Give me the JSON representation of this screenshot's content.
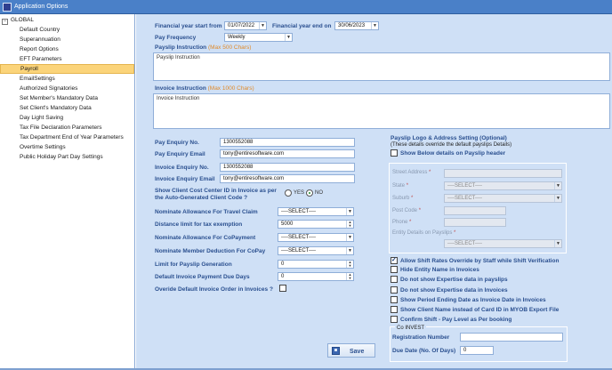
{
  "window": {
    "title": "Application Options"
  },
  "tree": {
    "root_label": "GLOBAL",
    "items": [
      "Default Country",
      "Superannuation",
      "Report Options",
      "EFT Parameters",
      "Payroll",
      "EmailSettings",
      "Authorized Signatories",
      "Set Member's Mandatory Data",
      "Set Client's Mandatory Data",
      "Day Light Saving",
      "Tax File Declaration Parameters",
      "Tax Department End of Year Parameters",
      "Overtime Settings",
      "Public Holiday Part Day Settings"
    ],
    "selected": "Payroll"
  },
  "financial": {
    "start_label": "Financial year start from",
    "start_value": "01/07/2022",
    "end_label": "Financial year end on",
    "end_value": "30/06/2023"
  },
  "pay_frequency": {
    "label": "Pay Frequency",
    "value": "Weekly"
  },
  "payslip_instruction": {
    "label": "Payslip Instruction",
    "hint": "(Max 500 Chars)",
    "placeholder": "Payslip Instruction"
  },
  "invoice_instruction": {
    "label": "Invoice Instruction",
    "hint": "(Max 1000 Chars)",
    "placeholder": "Invoice Instruction"
  },
  "enquiry": {
    "pay_no_label": "Pay Enquiry No.",
    "pay_no_value": "1300552088",
    "pay_email_label": "Pay Enquiry Email",
    "pay_email_value": "tony@entiresoftware.com",
    "inv_no_label": "Invoice Enquiry No.",
    "inv_no_value": "1300552088",
    "inv_email_label": "Invoice Enquiry Email",
    "inv_email_value": "tony@entiresoftware.com"
  },
  "cost_center": {
    "label_line1": "Show Client Cost Center ID in Invoice as per",
    "label_line2": "the Auto-Generated Client Code ?",
    "yes": "YES",
    "no": "NO",
    "selected": "NO"
  },
  "settings": {
    "travel_label": "Nominate Allowance For Travel Claim",
    "travel_value": "----SELECT----",
    "distance_label": "Distance limit for tax exemption",
    "distance_value": "5000",
    "copayment_label": "Nominate Allowance For CoPayment",
    "copayment_value": "----SELECT----",
    "deduction_label": "Nominate Member Deduction For CoPay",
    "deduction_value": "----SELECT----",
    "limit_label": "Limit for Payslip Generation",
    "limit_value": "0",
    "due_label": "Default Invoice Payment Due Days",
    "due_value": "0",
    "override_label": "Overide Default Invoice Order in Invoices ?"
  },
  "logo": {
    "title": "Payslip Logo & Address Setting (Optional)",
    "subtitle": "(These details override the default payslips Details)",
    "show_label": "Show Below details on Payslip header",
    "street_label": "Street Address",
    "state_label": "State",
    "state_value": "----SELECT----",
    "suburb_label": "Suburb",
    "suburb_value": "----SELECT----",
    "postcode_label": "Post Code",
    "phone_label": "Phone",
    "entity_label": "Entity Details on Payslips",
    "entity_value": "----SELECT----",
    "required_mark": "*"
  },
  "options": [
    {
      "label": "Allow Shift Rates Override by Staff while Shift Verification",
      "checked": true
    },
    {
      "label": "Hide Entity Name in Invoices",
      "checked": false
    },
    {
      "label": "Do not show Expertise data in payslips",
      "checked": false
    },
    {
      "label": "Do not show Expertise data in Invoices",
      "checked": false
    },
    {
      "label": "Show Period Ending Date as Invoice Date in Invoices",
      "checked": false
    },
    {
      "label": "Show Client Name instead of Card ID in MYOB Export File",
      "checked": false
    },
    {
      "label": "Confirm Shift - Pay Level as Per booking",
      "checked": false
    }
  ],
  "coinvest": {
    "title": "Co INVEST",
    "reg_label": "Registration Number",
    "reg_value": "",
    "due_label": "Due Date (No. Of Days)",
    "due_value": "0"
  },
  "save_button": {
    "label": "Save"
  }
}
